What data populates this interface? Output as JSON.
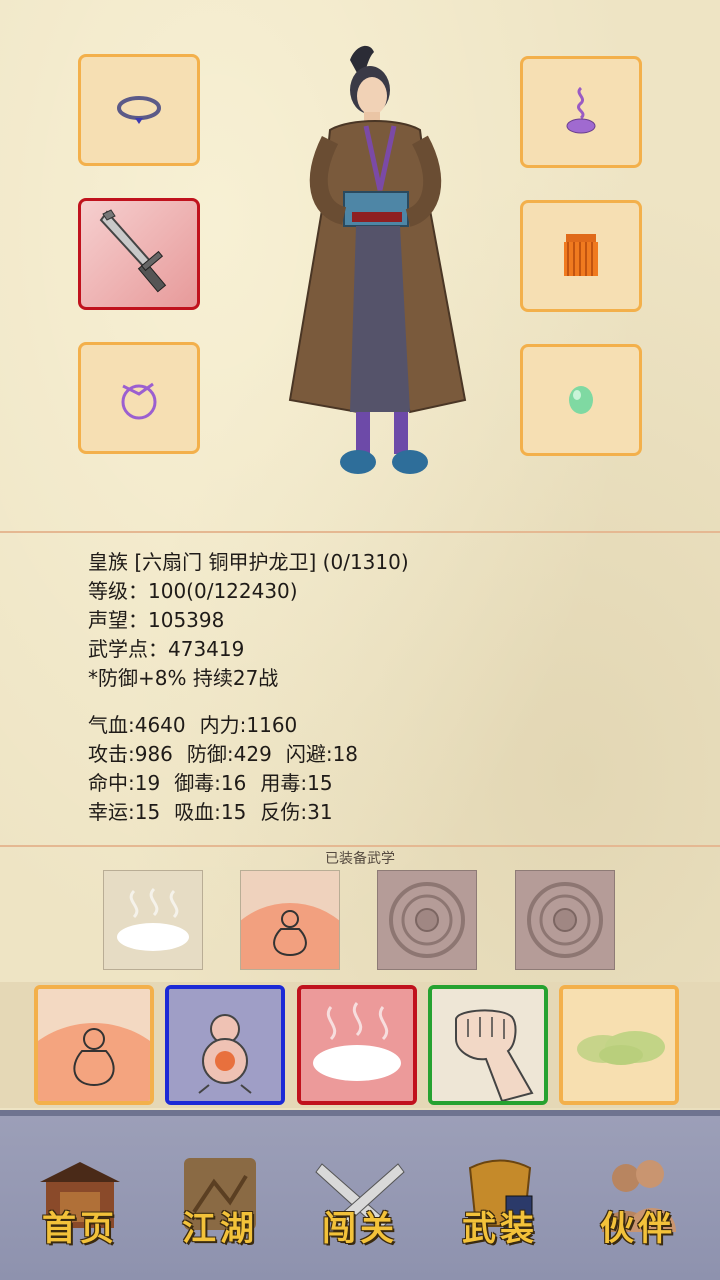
{
  "character": {
    "title_line": "皇族 [六扇门 铜甲护龙卫] (0/1310)",
    "level_line": "等级：100(0/122430)",
    "reputation_line": "声望：105398",
    "martial_points_line": "武学点：473419",
    "buff_line": "*防御+8% 持续27战"
  },
  "stats": [
    [
      "气血:4640",
      "内力:1160"
    ],
    [
      "攻击:986",
      "防御:429",
      "闪避:18"
    ],
    [
      "命中:19",
      "御毒:16",
      "用毒:15"
    ],
    [
      "幸运:15",
      "吸血:15",
      "反伤:31"
    ]
  ],
  "equipment": {
    "left": [
      {
        "icon": "necklace-icon",
        "selected": false
      },
      {
        "icon": "sword-icon",
        "selected": true
      },
      {
        "icon": "ring-icon",
        "selected": false
      }
    ],
    "right": [
      {
        "icon": "incense-icon",
        "selected": false
      },
      {
        "icon": "tassel-icon",
        "selected": false
      },
      {
        "icon": "jade-icon",
        "selected": false
      }
    ]
  },
  "equipped_martial_arts": {
    "title": "已装备武学"
  },
  "skill_cards": [
    {
      "icon": "meditation-icon",
      "border": "#f3b04b"
    },
    {
      "icon": "gourd-icon",
      "border": "#1c2ad6"
    },
    {
      "icon": "white-mist-icon",
      "border": "#c0121d"
    },
    {
      "icon": "fist-icon",
      "border": "#26a230"
    },
    {
      "icon": "green-mist-icon",
      "border": "#f3b04b"
    }
  ],
  "nav": [
    {
      "label": "首页",
      "icon": "house-icon"
    },
    {
      "label": "江湖",
      "icon": "scroll-map-icon"
    },
    {
      "label": "闯关",
      "icon": "crossed-swords-icon"
    },
    {
      "label": "武装",
      "icon": "armor-icon"
    },
    {
      "label": "伙伴",
      "icon": "partners-icon"
    }
  ]
}
